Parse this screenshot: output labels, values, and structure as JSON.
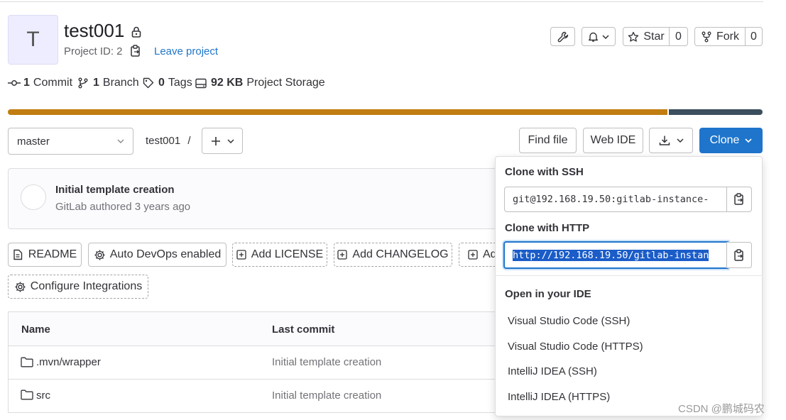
{
  "project": {
    "avatar_letter": "T",
    "title": "test001",
    "id_label": "Project ID: 2",
    "leave_label": "Leave project"
  },
  "header_actions": {
    "star_label": "Star",
    "star_count": "0",
    "fork_label": "Fork",
    "fork_count": "0"
  },
  "stats": {
    "commits_count": "1",
    "commits_label": "Commit",
    "branches_count": "1",
    "branches_label": "Branch",
    "tags_count": "0",
    "tags_label": "Tags",
    "storage_value": "92 KB",
    "storage_label": "Project Storage"
  },
  "language_bar": {
    "colors": [
      "#c17d10",
      "#3b4f5e"
    ]
  },
  "repo_bar": {
    "branch": "master",
    "breadcrumb": "test001",
    "separator": "/",
    "find_file": "Find file",
    "web_ide": "Web IDE",
    "clone": "Clone"
  },
  "last_commit": {
    "title": "Initial template creation",
    "subtitle": "GitLab authored 3 years ago"
  },
  "quick_links": {
    "readme": "README",
    "auto_devops": "Auto DevOps enabled",
    "add_license": "Add LICENSE",
    "add_changelog": "Add CHANGELOG",
    "add_truncated": "Ad",
    "configure_integrations": "Configure Integrations"
  },
  "file_table": {
    "columns": [
      "Name",
      "Last commit"
    ],
    "rows": [
      {
        "name": ".mvn/wrapper",
        "commit": "Initial template creation"
      },
      {
        "name": "src",
        "commit": "Initial template creation"
      }
    ]
  },
  "clone_dropdown": {
    "ssh_heading": "Clone with SSH",
    "ssh_url": "git@192.168.19.50:gitlab-instance-",
    "http_heading": "Clone with HTTP",
    "http_url": "http://192.168.19.50/gitlab-instan",
    "ide_heading": "Open in your IDE",
    "ide_items": [
      "Visual Studio Code (SSH)",
      "Visual Studio Code (HTTPS)",
      "IntelliJ IDEA (SSH)",
      "IntelliJ IDEA (HTTPS)"
    ]
  },
  "watermark": "CSDN @鹏城码农",
  "colors": {
    "primary": "#1f75cb",
    "border": "#dcdcde",
    "text": "#333238"
  }
}
